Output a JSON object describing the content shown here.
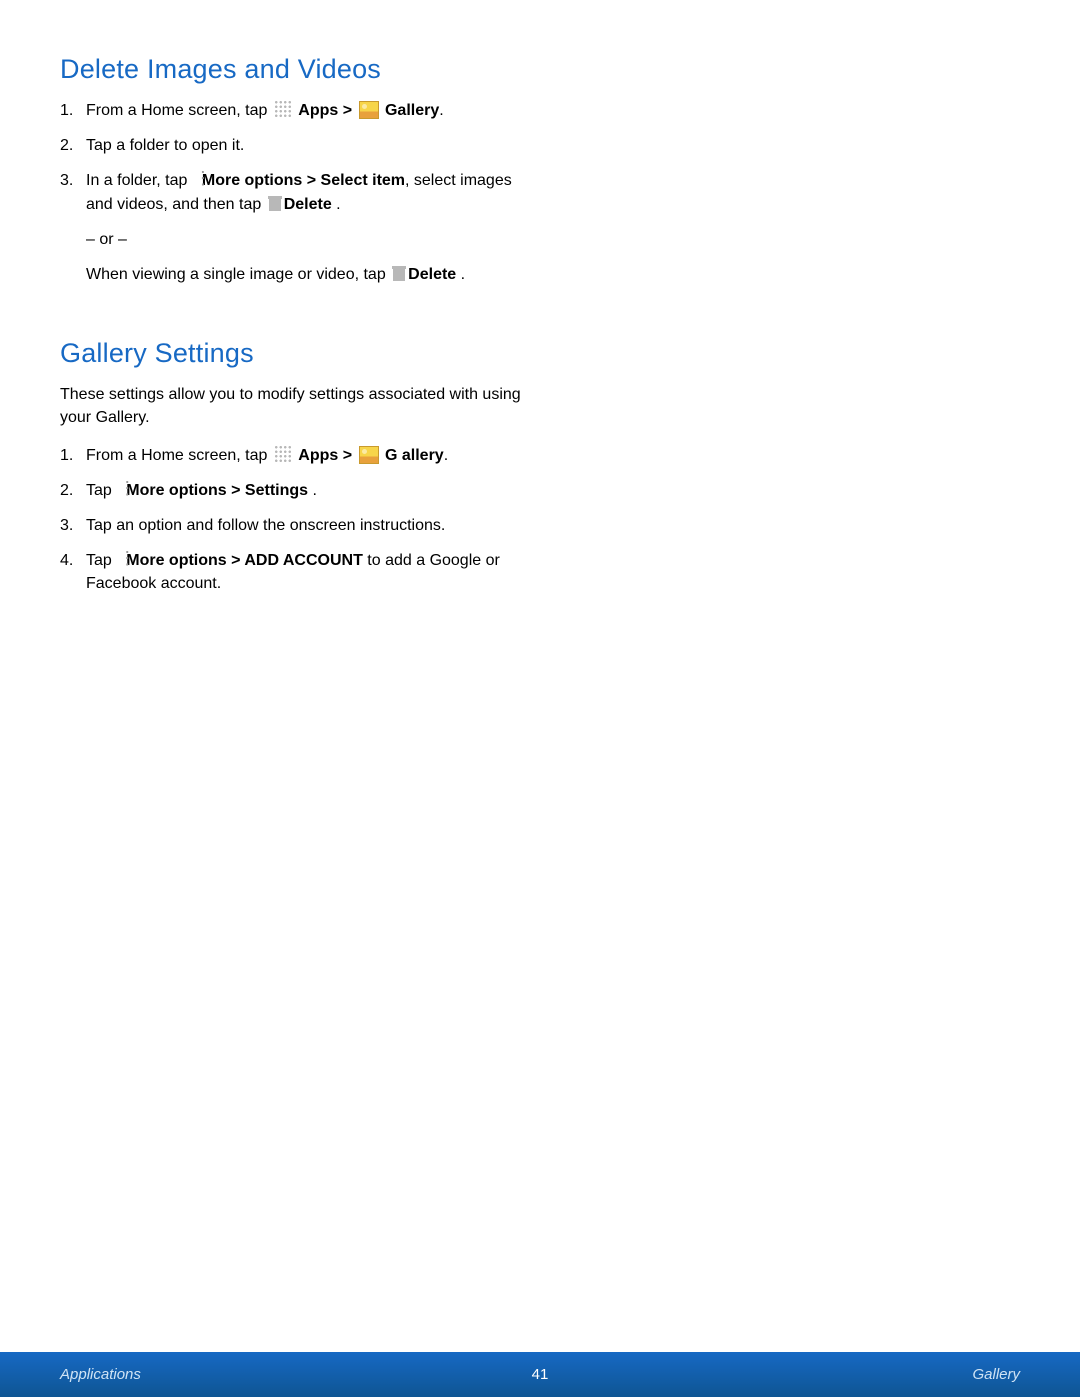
{
  "section1": {
    "heading": "Delete Images and Videos",
    "steps": {
      "1": {
        "prefix": "From a Home screen, tap ",
        "apps": "Apps > ",
        "gallery": " Gallery",
        "suffix": "."
      },
      "2": "Tap a folder to open it.",
      "3": {
        "line1_prefix": "In a folder, tap ",
        "line1_bold": "More options > Select item",
        "line1_suffix": ", select images and videos, and then tap ",
        "delete1": "Delete ",
        "period1": ".",
        "or": "– or –",
        "line3": "When viewing a single image or video, tap ",
        "delete2": "Delete ",
        "period2": "."
      }
    }
  },
  "section2": {
    "heading": "Gallery Settings",
    "intro": "These settings allow you to modify settings associated with using your Gallery.",
    "steps": {
      "1": {
        "prefix": "From a Home screen, tap ",
        "apps": "Apps > ",
        "gallery": "G allery",
        "suffix": "."
      },
      "2": {
        "prefix": "Tap ",
        "bold": "More options > Settings ",
        "suffix": "."
      },
      "3": "Tap an option and follow the onscreen instructions.",
      "4": {
        "prefix": "Tap ",
        "bold": "More options > ADD ACCOUNT",
        "suffix": " to add a Google or Facebook account."
      }
    }
  },
  "footer": {
    "left": "Applications",
    "center": "41",
    "right": "Gallery"
  }
}
